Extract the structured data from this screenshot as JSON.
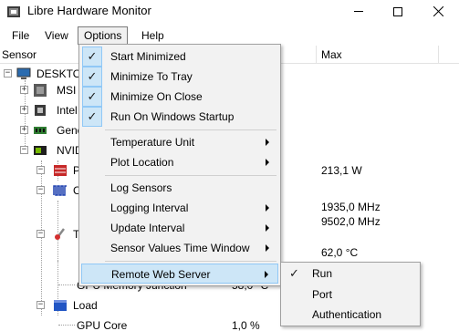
{
  "window": {
    "title": "Libre Hardware Monitor",
    "icon": "libre-hardware-monitor-icon"
  },
  "menubar": {
    "items": [
      "File",
      "View",
      "Options",
      "Help"
    ]
  },
  "tree_header": {
    "sensor": "Sensor",
    "max": "Max"
  },
  "tree": {
    "root": "DESKTO",
    "hardware": [
      "MSI",
      "Intel",
      "Gene",
      "NVID"
    ],
    "gpu_rows": [
      {
        "label": "GPU Memory Junction",
        "value": "58,0 °C"
      },
      {
        "label": "Load",
        "value": ""
      },
      {
        "label": "GPU Core",
        "value": "1,0 %"
      }
    ],
    "max_values": [
      "213,1 W",
      "1935,0 MHz",
      "9502,0 MHz",
      "62,0 °C"
    ],
    "partial_labels": [
      "P",
      "C",
      "T"
    ]
  },
  "options_menu": {
    "items": [
      {
        "label": "Start Minimized",
        "checked": true
      },
      {
        "label": "Minimize To Tray",
        "checked": true
      },
      {
        "label": "Minimize On Close",
        "checked": true
      },
      {
        "label": "Run On Windows Startup",
        "checked": true
      },
      {
        "label": "Temperature Unit",
        "submenu": true
      },
      {
        "label": "Plot Location",
        "submenu": true
      },
      {
        "label": "Log Sensors"
      },
      {
        "label": "Logging Interval",
        "submenu": true
      },
      {
        "label": "Update Interval",
        "submenu": true
      },
      {
        "label": "Sensor Values Time Window",
        "submenu": true
      },
      {
        "label": "Remote Web Server",
        "submenu": true,
        "highlighted": true
      }
    ]
  },
  "remote_web_server_menu": {
    "items": [
      {
        "label": "Run",
        "checked": true
      },
      {
        "label": "Port"
      },
      {
        "label": "Authentication"
      }
    ]
  },
  "colors": {
    "highlight": "#cde6f7",
    "highlight_border": "#90c8f6",
    "menu_bg": "#f2f2f2"
  }
}
